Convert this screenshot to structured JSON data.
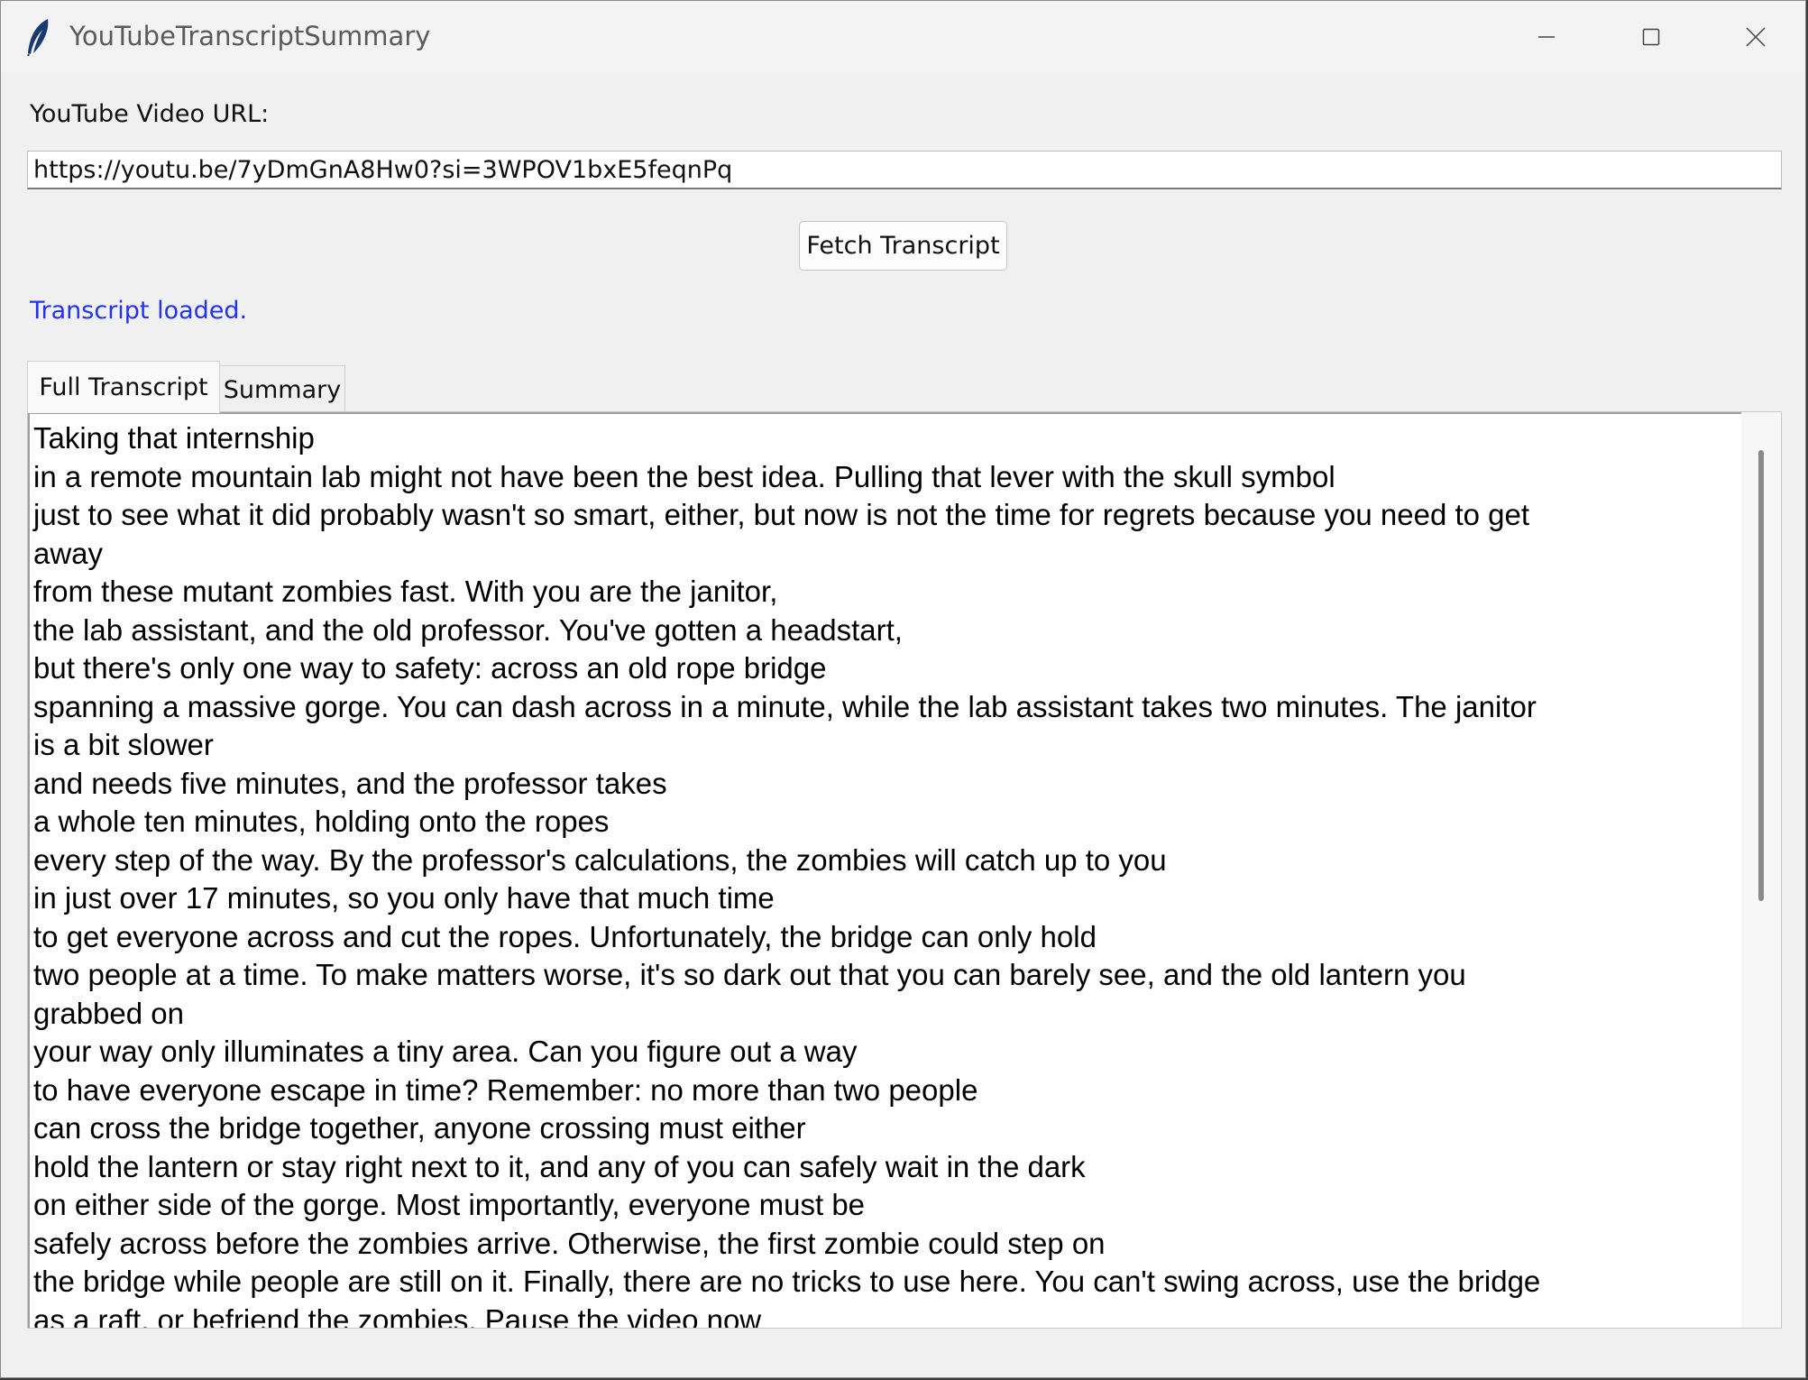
{
  "window": {
    "title": "YouTubeTranscriptSummary"
  },
  "form": {
    "url_label": "YouTube Video URL:",
    "url_value": "https://youtu.be/7yDmGnA8Hw0?si=3WPOV1bxE5feqnPq",
    "fetch_label": "Fetch Transcript",
    "status_text": "Transcript loaded.",
    "status_color": "#2233ee"
  },
  "tabs": [
    {
      "label": "Full Transcript",
      "active": true
    },
    {
      "label": "Summary",
      "active": false
    }
  ],
  "transcript": {
    "lines": [
      "Taking that internship",
      "in a remote mountain lab might not have been the best idea. Pulling that lever with the skull symbol",
      "just to see what it did probably wasn't so smart, either, but now is not the time for regrets because you need to get",
      "away",
      "from these mutant zombies fast. With you are the janitor,",
      "the lab assistant, and the old professor. You've gotten a headstart,",
      "but there's only one way to safety: across an old rope bridge",
      "spanning a massive gorge. You can dash across in a minute, while the lab assistant takes two minutes. The janitor",
      "is a bit slower",
      "and needs five minutes, and the professor takes",
      "a whole ten minutes, holding onto the ropes",
      "every step of the way. By the professor's calculations, the zombies will catch up to you",
      "in just over 17 minutes, so you only have that much time",
      "to get everyone across and cut the ropes. Unfortunately, the bridge can only hold",
      "two people at a time. To make matters worse, it's so dark out that you can barely see, and the old lantern you",
      "grabbed on",
      "your way only illuminates a tiny area. Can you figure out a way",
      "to have everyone escape in time? Remember: no more than two people",
      "can cross the bridge together, anyone crossing must either",
      "hold the lantern or stay right next to it, and any of you can safely wait in the dark",
      "on either side of the gorge. Most importantly, everyone must be",
      "safely across before the zombies arrive. Otherwise, the first zombie could step on",
      "the bridge while people are still on it. Finally, there are no tricks to use here. You can't swing across, use the bridge",
      "as a raft, or befriend the zombies. Pause the video now"
    ]
  }
}
